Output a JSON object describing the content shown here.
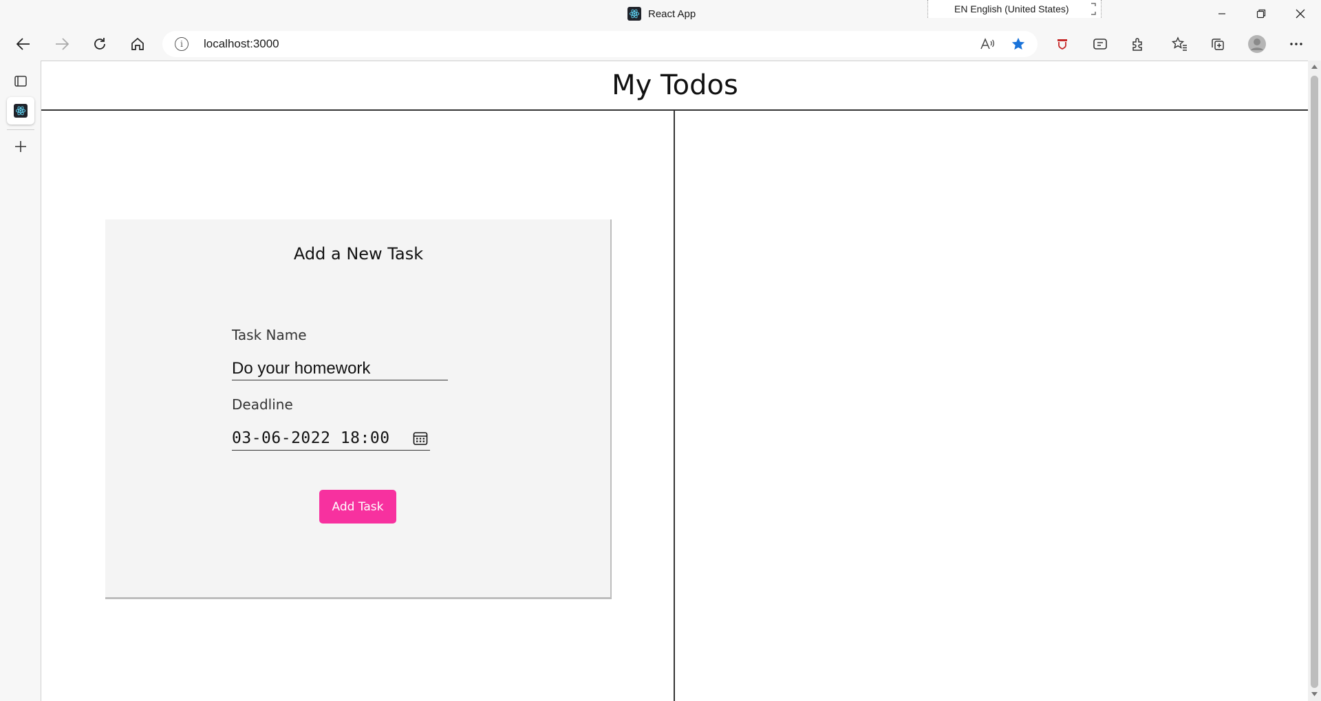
{
  "browser": {
    "window_title": "React App",
    "language_indicator": "EN English (United States)",
    "address": "localhost:3000"
  },
  "page": {
    "title": "My Todos",
    "form": {
      "heading": "Add a New Task",
      "task_name_label": "Task Name",
      "task_name_value": "Do your homework",
      "deadline_label": "Deadline",
      "deadline_value": "03-06-2022 18:00",
      "submit_label": "Add Task"
    }
  },
  "colors": {
    "accent": "#f7319f",
    "favorite_star": "#1a73d9"
  },
  "icons": [
    "back-icon",
    "forward-icon",
    "refresh-icon",
    "home-icon",
    "site-info-icon",
    "read-aloud-icon",
    "favorite-star-icon",
    "extensions-icon",
    "favorites-icon",
    "collections-icon",
    "profile-icon",
    "more-icon",
    "tab-actions-icon",
    "react-tab-icon",
    "new-tab-icon",
    "calendar-icon"
  ]
}
